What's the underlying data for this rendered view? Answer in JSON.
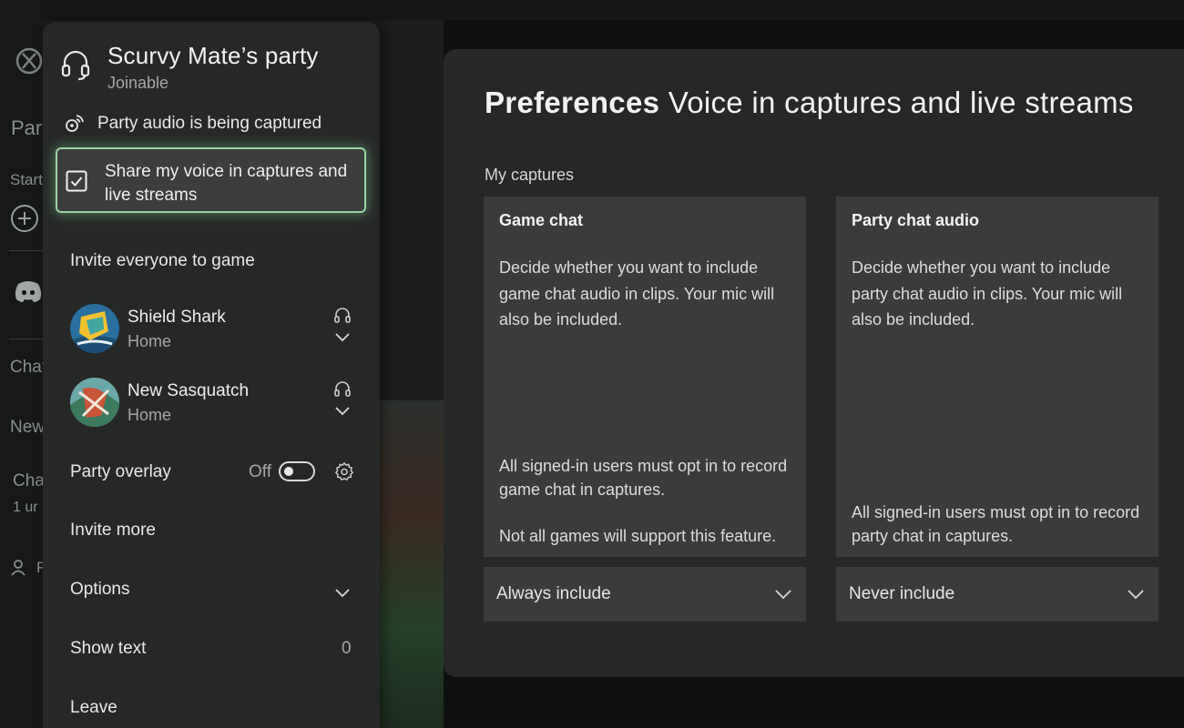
{
  "background": {
    "nav_fragments": [
      "Par",
      "Start",
      "Chat",
      "New",
      "Cha",
      "1 ur",
      "P"
    ],
    "discord_icon": "discord-icon",
    "xbox_icon": "xbox-logo-icon"
  },
  "party": {
    "title": "Scurvy Mate’s party",
    "subtitle": "Joinable",
    "header_icon": "headset-icon",
    "capture_status": "Party audio is being captured",
    "share_voice": {
      "label": "Share my voice in captures and live streams",
      "checked": true
    },
    "invite_everyone": "Invite everyone to game",
    "members": [
      {
        "name": "Shield Shark",
        "status": "Home"
      },
      {
        "name": "New Sasquatch",
        "status": "Home"
      }
    ],
    "overlay": {
      "label": "Party overlay",
      "state": "Off",
      "enabled": false
    },
    "invite_more": "Invite more",
    "options": "Options",
    "show_text": {
      "label": "Show text",
      "count": "0"
    },
    "leave": "Leave"
  },
  "preferences": {
    "title_bold": "Preferences",
    "title_rest": "Voice in captures and live streams",
    "section_label": "My captures",
    "cards": [
      {
        "title": "Game chat",
        "description": "Decide whether you want to include game chat audio in clips. Your mic will also be included.",
        "note_1": "All signed-in users must opt in to record game chat in captures.",
        "note_2": "Not all games will support this feature.",
        "selection": "Always include"
      },
      {
        "title": "Party chat audio",
        "description": "Decide whether you want to include party chat audio in clips. Your mic will also be included.",
        "note_1": "All signed-in users must opt in to record party chat in captures.",
        "selection": "Never include"
      }
    ]
  },
  "colors": {
    "focus_glow": "#9ad3a4",
    "panel": "#262827",
    "card": "#3a3c3b"
  }
}
